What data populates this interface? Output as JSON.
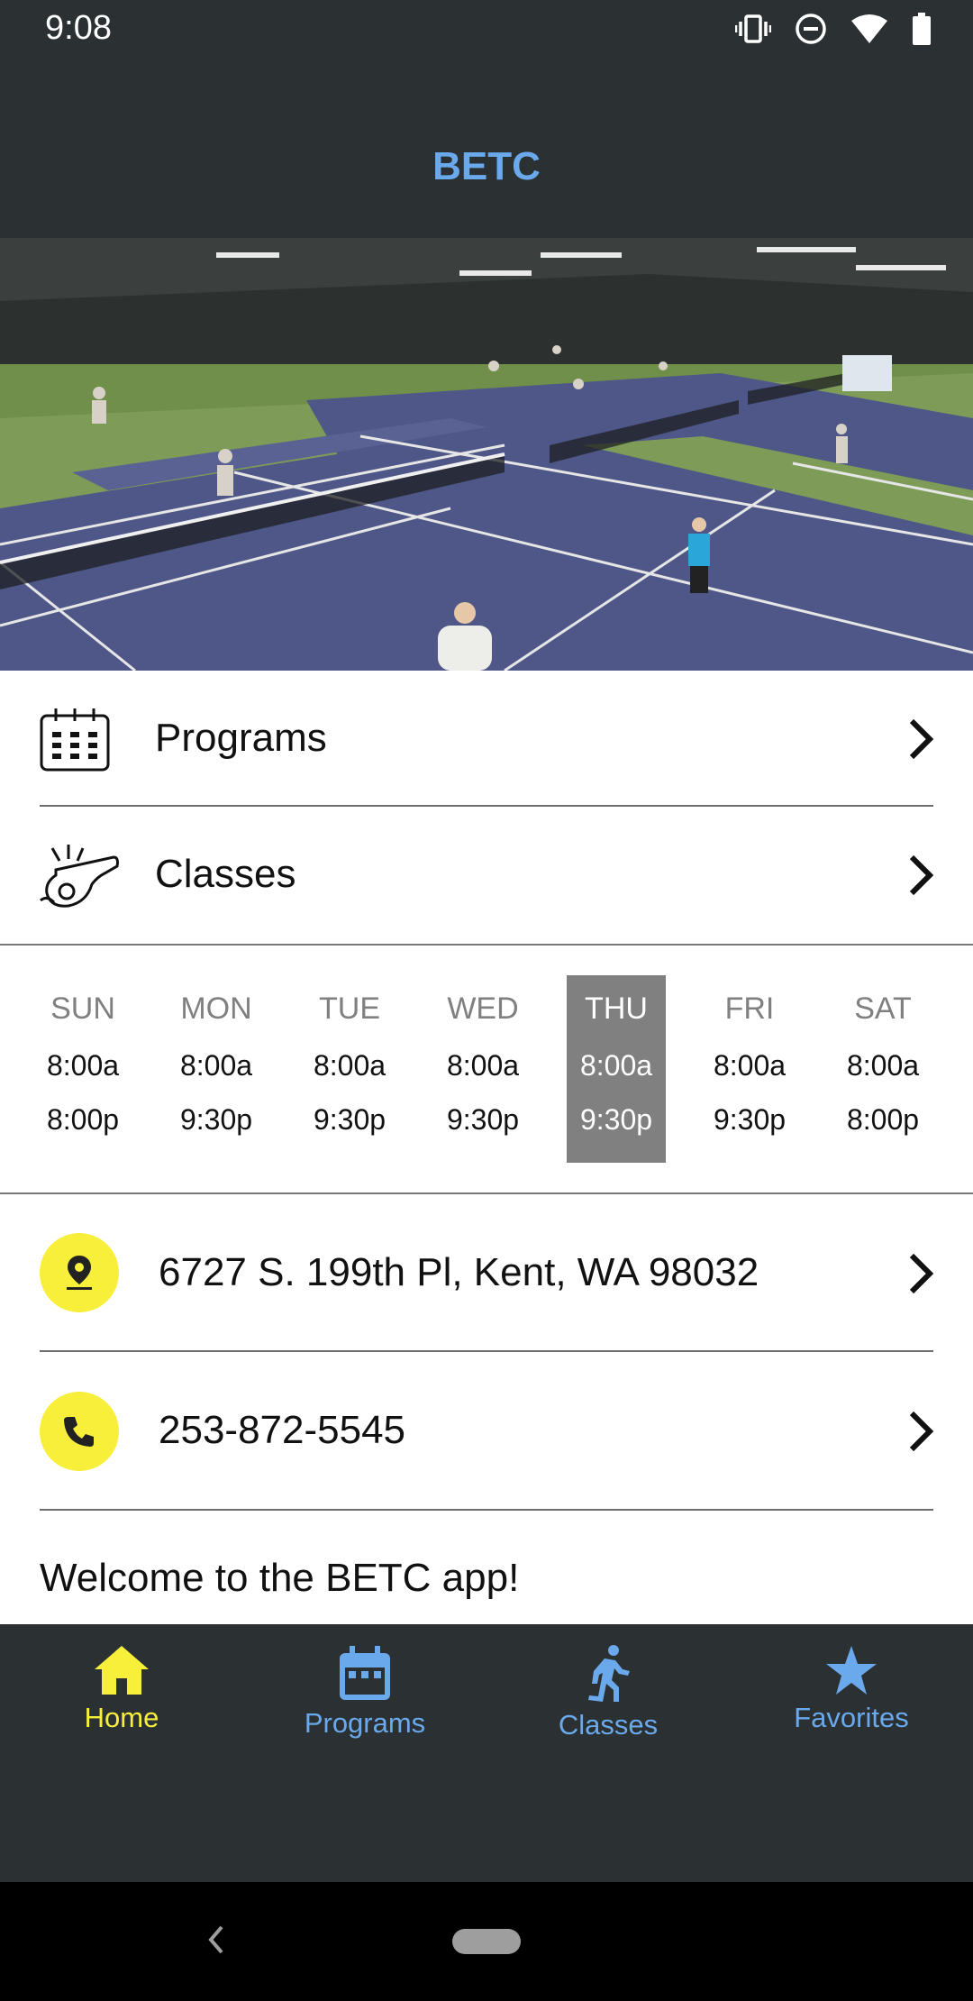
{
  "status_bar": {
    "time": "9:08",
    "icons": [
      "vibrate-icon",
      "do-not-disturb-icon",
      "wifi-icon",
      "battery-icon"
    ]
  },
  "app_bar": {
    "title": "BETC"
  },
  "hero": {
    "image": "indoor tennis courts photo"
  },
  "menu": [
    {
      "label": "Programs",
      "icon": "calendar-grid-icon"
    },
    {
      "label": "Classes",
      "icon": "whistle-icon"
    }
  ],
  "hours": {
    "days": [
      {
        "name": "SUN",
        "open": "8:00a",
        "close": "8:00p"
      },
      {
        "name": "MON",
        "open": "8:00a",
        "close": "9:30p"
      },
      {
        "name": "TUE",
        "open": "8:00a",
        "close": "9:30p"
      },
      {
        "name": "WED",
        "open": "8:00a",
        "close": "9:30p"
      },
      {
        "name": "THU",
        "open": "8:00a",
        "close": "9:30p"
      },
      {
        "name": "FRI",
        "open": "8:00a",
        "close": "9:30p"
      },
      {
        "name": "SAT",
        "open": "8:00a",
        "close": "8:00p"
      }
    ],
    "highlighted_day": "THU"
  },
  "contact": {
    "address": "6727 S. 199th Pl, Kent, WA 98032",
    "phone": "253-872-5545"
  },
  "welcome": "Welcome to the BETC app!",
  "bottom_nav": [
    {
      "label": "Home",
      "icon": "home-icon",
      "active": true
    },
    {
      "label": "Programs",
      "icon": "calendar-icon",
      "active": false
    },
    {
      "label": "Classes",
      "icon": "runner-icon",
      "active": false
    },
    {
      "label": "Favorites",
      "icon": "star-icon",
      "active": false
    }
  ],
  "colors": {
    "bar_background": "#2b3033",
    "accent_blue": "#6aa9ec",
    "accent_yellow": "#f7ef3a",
    "highlight_gray": "#808080"
  }
}
